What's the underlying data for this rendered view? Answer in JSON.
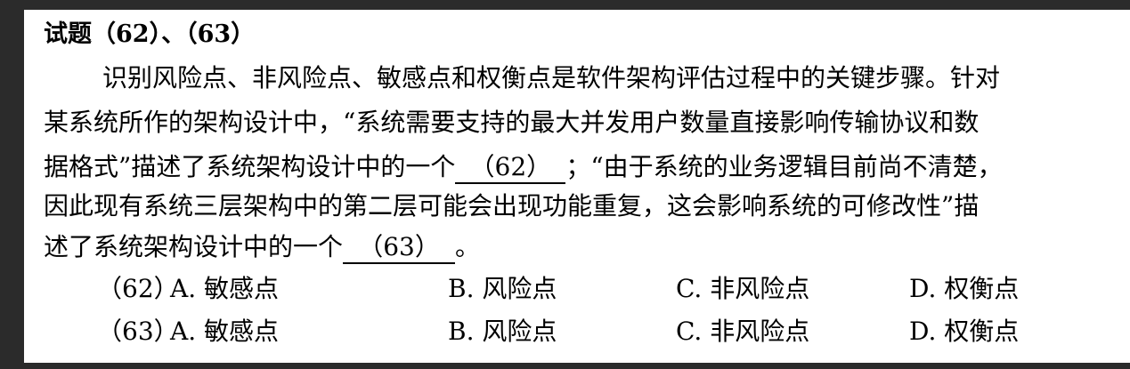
{
  "question": {
    "title": "试题（62）、（63）",
    "lines": [
      "识别风险点、非风险点、敏感点和权衡点是软件架构评估过程中的关键步骤。针对",
      "某系统所作的架构设计中，“系统需要支持的最大并发用户数量直接影响传输协议和数",
      "据格式”描述了系统架构设计中的一个",
      "；“由于系统的业务逻辑目前尚不清楚，",
      "因此现有系统三层架构中的第二层可能会出现功能重复，这会影响系统的可修改性”描",
      "述了系统架构设计中的一个",
      "。"
    ],
    "blank62": "（62）",
    "blank63": "（63）"
  },
  "options": [
    {
      "number": "（62）",
      "a": "A. 敏感点",
      "b": "B. 风险点",
      "c": "C. 非风险点",
      "d": "D. 权衡点"
    },
    {
      "number": "（63）",
      "a": "A. 敏感点",
      "b": "B. 风险点",
      "c": "C. 非风险点",
      "d": "D. 权衡点"
    }
  ]
}
